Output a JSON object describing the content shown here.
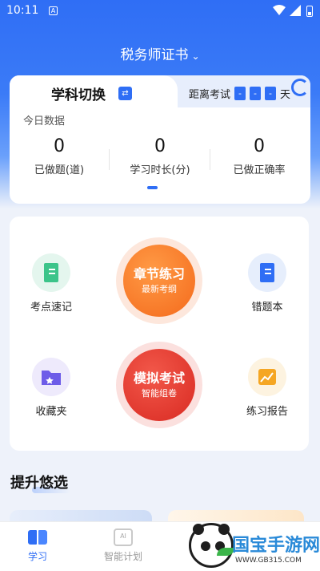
{
  "status_bar": {
    "time": "10:11",
    "notif_icon": "A"
  },
  "header": {
    "title": "税务师证书",
    "chevron": "⌄"
  },
  "stats_card": {
    "subject_switch_label": "学科切换",
    "swap_icon": "⇄",
    "countdown": {
      "prefix": "距离考试",
      "digits": [
        "-",
        "-",
        "-"
      ],
      "unit": "天"
    },
    "today_label": "今日数据",
    "stats": [
      {
        "value": "0",
        "label": "已做题(道)"
      },
      {
        "value": "0",
        "label": "学习时长(分)"
      },
      {
        "value": "0",
        "label": "已做正确率"
      }
    ]
  },
  "features": {
    "quick_notes": "考点速记",
    "wrong_book": "错题本",
    "favorites": "收藏夹",
    "report": "练习报告",
    "chapter_practice": {
      "title": "章节练习",
      "subtitle": "最新考纲"
    },
    "mock_exam": {
      "title": "模拟考试",
      "subtitle": "智能组卷"
    }
  },
  "promo": {
    "title": "提升悠选"
  },
  "bottom_nav": [
    {
      "label": "学习",
      "active": true
    },
    {
      "label": "智能计划",
      "active": false
    }
  ],
  "watermark": {
    "brand": "国宝手游网",
    "url": "WWW.GB315.COM"
  },
  "colors": {
    "accent": "#2f6ef5",
    "orange": "#ff7a2a",
    "red": "#e8392e"
  },
  "icons": [
    "book-icon",
    "swap-icon",
    "refresh-icon",
    "folder-icon",
    "chart-icon",
    "study-icon",
    "ai-icon"
  ]
}
